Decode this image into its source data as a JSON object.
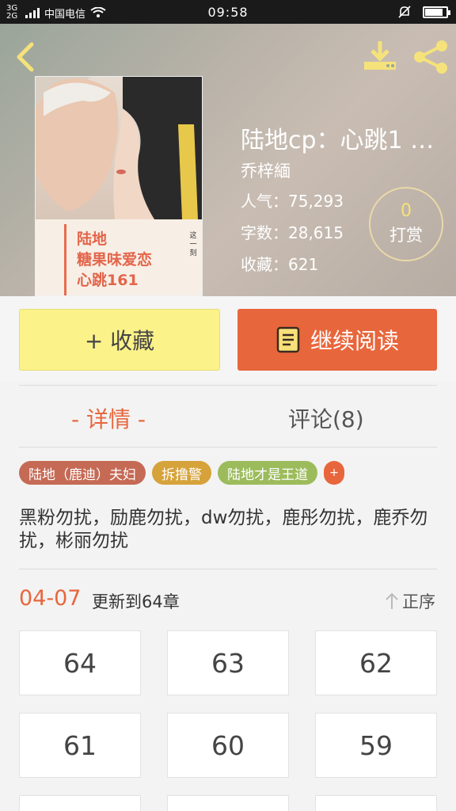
{
  "status_bar": {
    "network": "3G 2G",
    "carrier": "中国电信",
    "time": "09:58",
    "battery_level": 0.85
  },
  "header": {
    "back_icon": "chevron-left-icon",
    "download_icon": "download-icon",
    "share_icon": "share-icon",
    "title": "陆地cp：心跳1 …",
    "author": "乔梓緬",
    "popularity": "人气：75,293",
    "word_count": "字数：28,615",
    "favorites": "收藏：621",
    "reward": {
      "count": "0",
      "label": "打赏"
    },
    "cover": {
      "title_lines": [
        "陆地",
        "糖果味爱恋",
        "心跳161"
      ],
      "side_text": "这一刻"
    }
  },
  "actions": {
    "favorite_label": "+ 收藏",
    "read_label": "继续阅读",
    "read_icon": "book-icon"
  },
  "tabs": {
    "detail": "- 详情 -",
    "comment": "评论(8)"
  },
  "tags": [
    {
      "label": "陆地（鹿迪）夫妇",
      "color": "#c56a55"
    },
    {
      "label": "拆撸警",
      "color": "#d6a23a"
    },
    {
      "label": "陆地才是王道",
      "color": "#9cbc5c"
    }
  ],
  "tag_more": "+",
  "description": "黑粉勿扰，励鹿勿扰，dw勿扰，鹿彤勿扰，鹿乔勿扰，彬丽勿扰",
  "update": {
    "date": "04-07",
    "text": "更新到64章",
    "sort_label": "正序",
    "sort_icon": "arrow-up-icon"
  },
  "chapters": [
    "64",
    "63",
    "62",
    "61",
    "60",
    "59"
  ],
  "colors": {
    "accent": "#e8663c",
    "favorite_bg": "#fbf28a",
    "reward_count": "#f5e27a"
  }
}
